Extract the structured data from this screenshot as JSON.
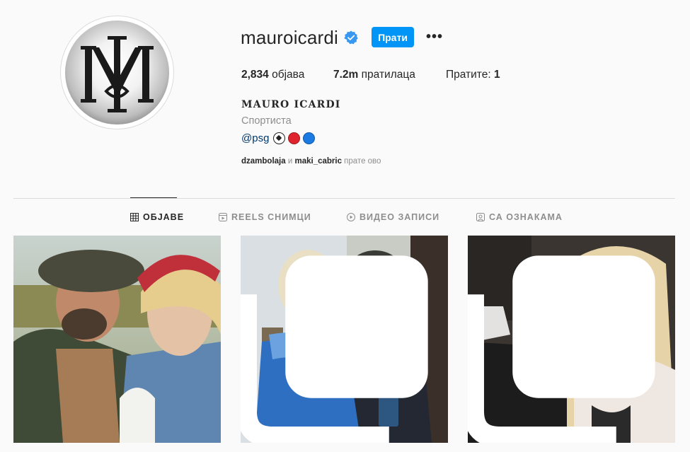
{
  "profile": {
    "username": "mauroicardi",
    "follow_label": "Прати",
    "more_label": "•••",
    "full_name": "MAURO ICARDI",
    "category": "Спортиста",
    "bio_mention": "@psg",
    "stats": {
      "posts_count": "2,834",
      "posts_label": " објава",
      "followers_count": "7.2m",
      "followers_label": " пратилаца",
      "following_label": "Пратите: ",
      "following_count": "1"
    },
    "followed_by": {
      "user1": "dzambolaja",
      "conj": " и ",
      "user2": "maki_cabric",
      "suffix": " прате ово"
    }
  },
  "tabs": [
    {
      "label": "ОБЈАВЕ",
      "icon": "grid-icon",
      "active": true
    },
    {
      "label": "REELS СНИМЦИ",
      "icon": "reels-icon",
      "active": false
    },
    {
      "label": "ВИДЕО ЗАПИСИ",
      "icon": "video-icon",
      "active": false
    },
    {
      "label": "СА ОЗНАКАМА",
      "icon": "tagged-icon",
      "active": false
    }
  ],
  "colors": {
    "accent": "#0095f6",
    "verified": "#3897f0",
    "muted": "#8e8e8e",
    "link": "#00376b"
  }
}
